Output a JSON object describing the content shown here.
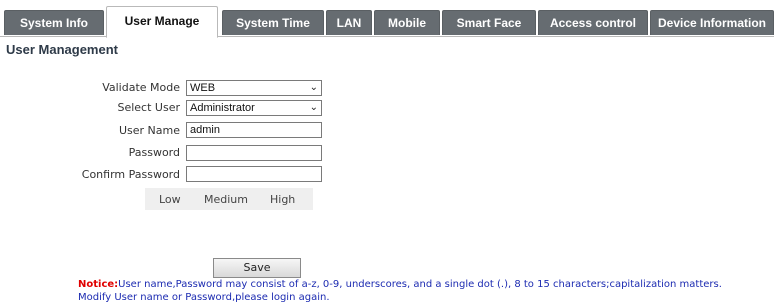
{
  "tabs": [
    {
      "label": "System Info"
    },
    {
      "label": "User Manage"
    },
    {
      "label": "System Time"
    },
    {
      "label": "LAN"
    },
    {
      "label": "Mobile"
    },
    {
      "label": "Smart Face"
    },
    {
      "label": "Access control"
    },
    {
      "label": "Device Information"
    }
  ],
  "active_tab": "User Manage",
  "section_title": "User Management",
  "form": {
    "validate_mode": {
      "label": "Validate Mode",
      "value": "WEB"
    },
    "select_user": {
      "label": "Select User",
      "value": "Administrator"
    },
    "user_name": {
      "label": "User Name",
      "value": "admin"
    },
    "password": {
      "label": "Password",
      "value": ""
    },
    "confirm_password": {
      "label": "Confirm Password",
      "value": ""
    }
  },
  "strength": {
    "low": "Low",
    "medium": "Medium",
    "high": "High"
  },
  "save_label": "Save",
  "notice": {
    "prefix": "Notice:",
    "line1": "User name,Password may consist of a-z, 0-9, underscores, and a single dot (.), 8 to 15 characters;capitalization matters.",
    "line2": "Modify User name or Password,please login again."
  },
  "icons": {
    "dropdown": "chevron-down-icon"
  }
}
